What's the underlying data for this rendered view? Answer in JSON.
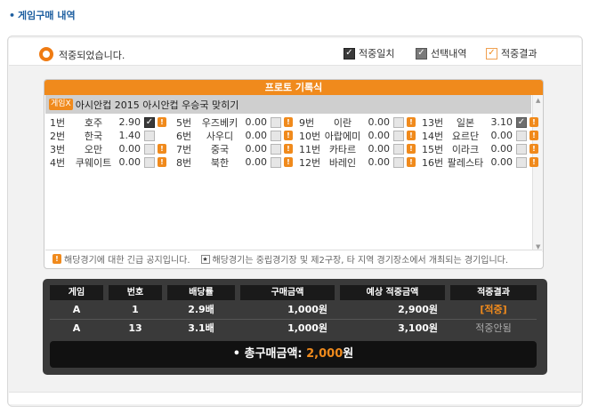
{
  "page": {
    "section_title": "게임구매 내역"
  },
  "status": {
    "text": "적중되었습니다."
  },
  "legend": [
    {
      "label": "적중일치",
      "icon": "check-dark-icon"
    },
    {
      "label": "선택내역",
      "icon": "check-gray-icon"
    },
    {
      "label": "적중결과",
      "icon": "check-orange-icon"
    }
  ],
  "panel": {
    "header": "프로토 기록식",
    "game_badge": "게임X",
    "game_title": "아시안컵 2015 아시안컵 우승국 맞히기",
    "teams": [
      {
        "num": "1번",
        "name": "호주",
        "odds": "2.90",
        "state": "checked"
      },
      {
        "num": "2번",
        "name": "한국",
        "odds": "1.40",
        "state": "none"
      },
      {
        "num": "3번",
        "name": "오만",
        "odds": "0.00",
        "state": "warn"
      },
      {
        "num": "4번",
        "name": "쿠웨이트",
        "odds": "0.00",
        "state": "warn"
      },
      {
        "num": "5번",
        "name": "우즈베키",
        "odds": "0.00",
        "state": "warn"
      },
      {
        "num": "6번",
        "name": "사우디",
        "odds": "0.00",
        "state": "warn"
      },
      {
        "num": "7번",
        "name": "중국",
        "odds": "0.00",
        "state": "warn"
      },
      {
        "num": "8번",
        "name": "북한",
        "odds": "0.00",
        "state": "warn"
      },
      {
        "num": "9번",
        "name": "이란",
        "odds": "0.00",
        "state": "warn"
      },
      {
        "num": "10번",
        "name": "아랍에미",
        "odds": "0.00",
        "state": "warn"
      },
      {
        "num": "11번",
        "name": "카타르",
        "odds": "0.00",
        "state": "warn"
      },
      {
        "num": "12번",
        "name": "바레인",
        "odds": "0.00",
        "state": "warn"
      },
      {
        "num": "13번",
        "name": "일본",
        "odds": "3.10",
        "state": "checked-gray"
      },
      {
        "num": "14번",
        "name": "요르단",
        "odds": "0.00",
        "state": "warn"
      },
      {
        "num": "15번",
        "name": "이라크",
        "odds": "0.00",
        "state": "warn"
      },
      {
        "num": "16번",
        "name": "팔레스타",
        "odds": "0.00",
        "state": "warn"
      }
    ],
    "foot_warn_text": "해당경기에 대한 긴급 공지입니다.",
    "foot_star_text": "해당경기는 중립경기장 및 제2구장, 타 지역 경기장소에서 개최되는 경기입니다."
  },
  "table": {
    "headers": [
      "게임",
      "번호",
      "배당률",
      "구매금액",
      "예상 적중금액",
      "적중결과"
    ],
    "rows": [
      {
        "game": "A",
        "num": "1",
        "odds": "2.9배",
        "amount": "1,000원",
        "expected": "2,900원",
        "result": "[적중]",
        "hit": true
      },
      {
        "game": "A",
        "num": "13",
        "odds": "3.1배",
        "amount": "1,000원",
        "expected": "3,100원",
        "result": "적중안됨",
        "hit": false
      }
    ],
    "total_label": "총구매금액: ",
    "total_amount": "2,000",
    "total_unit": "원"
  },
  "colors": {
    "accent": "#f08a1c",
    "title_blue": "#1e5fa0",
    "dark_panel": "#3a3a3a"
  }
}
